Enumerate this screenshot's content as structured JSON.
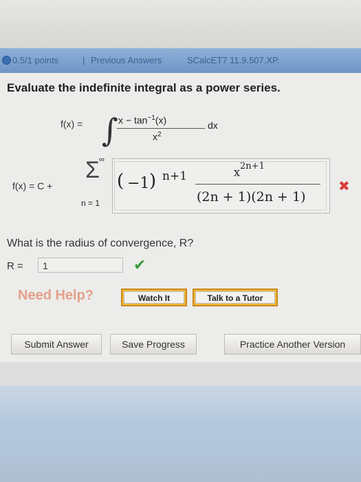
{
  "header": {
    "points": "0.5/1 points",
    "separator": "|",
    "previous_answers": "Previous Answers",
    "problem_id": "SCalcET7 11.9.507.XP."
  },
  "question": {
    "prompt": "Evaluate the indefinite integral as a power series.",
    "f_label": "f(x) =",
    "integrand_numerator": "x − tan",
    "integrand_superscript": "−1",
    "integrand_numerator_tail": "(x)",
    "integrand_denominator": "x",
    "integrand_denominator_exp": "2",
    "dx": "dx"
  },
  "series": {
    "lhs": "f(x) = C +",
    "sigma_top": "∞",
    "sigma_bottom": "n = 1",
    "factor": "−1",
    "factor_exp": "n+1",
    "term_numerator": "x",
    "term_numerator_exp": "2n+1",
    "term_denominator": "(2n + 1)(2n + 1)",
    "status": "incorrect"
  },
  "radius": {
    "prompt": "What is the radius of convergence, R?",
    "label": "R =",
    "value": "1",
    "status": "correct"
  },
  "help": {
    "label": "Need Help?",
    "watch_it": "Watch It",
    "talk_to_tutor": "Talk to a Tutor"
  },
  "actions": {
    "submit": "Submit Answer",
    "save": "Save Progress",
    "practice": "Practice Another Version"
  },
  "colors": {
    "header_bg": "#7096c6",
    "incorrect": "#d94040",
    "correct": "#3f9a3f",
    "help_accent": "#f4b93c"
  }
}
